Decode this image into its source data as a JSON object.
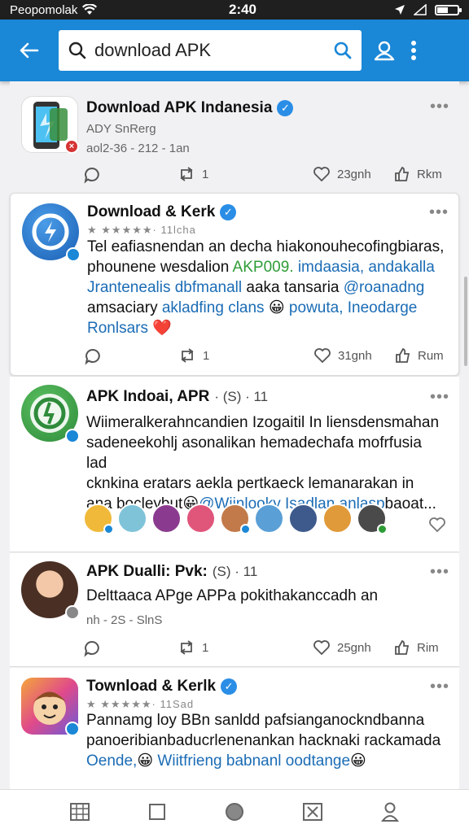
{
  "status": {
    "carrier": "Peopomolak",
    "time": "2:40"
  },
  "search": {
    "query": "download APK",
    "placeholder": ""
  },
  "posts": [
    {
      "title": "Download APK Indanesia",
      "meta1": "ADY SnRerg",
      "meta2": "aol2-36 - 212 - 1an",
      "reply_count": "1",
      "like_count": "23gnh",
      "share_label": "Rkm"
    },
    {
      "title": "Download & Kerk",
      "rating": "★ ★★★★★· 11lcha",
      "body": {
        "line1": "Tel eafiasnendan an decha hiakonouhecofingbiaras,",
        "line2a": "phounene wesdalion ",
        "line2b": "AKP009.",
        "line2c": " imdaasia, andakalla",
        "line3a": "Jrantenealis dbfmanall",
        "line3b": " aaka tansaria ",
        "line3c": "@roanadng",
        "line4a": "amsaciary ",
        "line4b": "akladfing clans",
        "line4c": "😀",
        "line4d": " powuta, Ineodarge",
        "line5": "Ronlsars",
        "line5_emoji": "❤️"
      },
      "reply_count": "1",
      "like_count": "31gnh",
      "share_label": "Rum"
    },
    {
      "title": "APK Indoai, APR",
      "title_suffix": "· (S) · 11",
      "body": {
        "line1": "Wiimeralkerahncandien Izogaitil In liensdensmahan",
        "line2": "sadeneekohlj asonalikan hemadechafa mofrfusia lad",
        "line3": "cknkina eratars aekla pertkaeck lemanarakan in",
        "line4a": "ana boclеybut",
        "line4b": "😀",
        "line4c": "@Wiinlooky Isadlan anlasp",
        "line4d": "baoat..."
      }
    },
    {
      "title": "APK Dualli: Pvk:",
      "title_suffix": "(S) · 11",
      "body": "Delttaaca APge APPa pokithakancсadh an",
      "meta": "nh - 2S - SlnS",
      "reply_count": "1",
      "like_count": "25gnh",
      "share_label": "Rim"
    },
    {
      "title": "Townload & Kerlk",
      "rating": "★ ★★★★★· 11Sad",
      "body": {
        "line1": "Pannamg loy BBn sanldd pafsianganockndbanna",
        "line2": "panoeribianbaducrlenenankan hacknaki rackamada",
        "line3a": "Oende,",
        "line3b": "😀",
        "line3c": " Wiitfrieng babnanl oodtange",
        "line3d": "😀"
      }
    }
  ],
  "colors": {
    "appbar": "#1a87d7",
    "link": "#1b6cb5",
    "link_green": "#2e9c36"
  },
  "icons": [
    "back-arrow-icon",
    "search-icon",
    "search-submit-icon",
    "profile-icon",
    "overflow-menu-icon",
    "reply-icon",
    "repost-icon",
    "heart-icon",
    "share-icon",
    "grid-icon",
    "square-icon",
    "circle-icon",
    "close-box-icon",
    "person-icon"
  ]
}
